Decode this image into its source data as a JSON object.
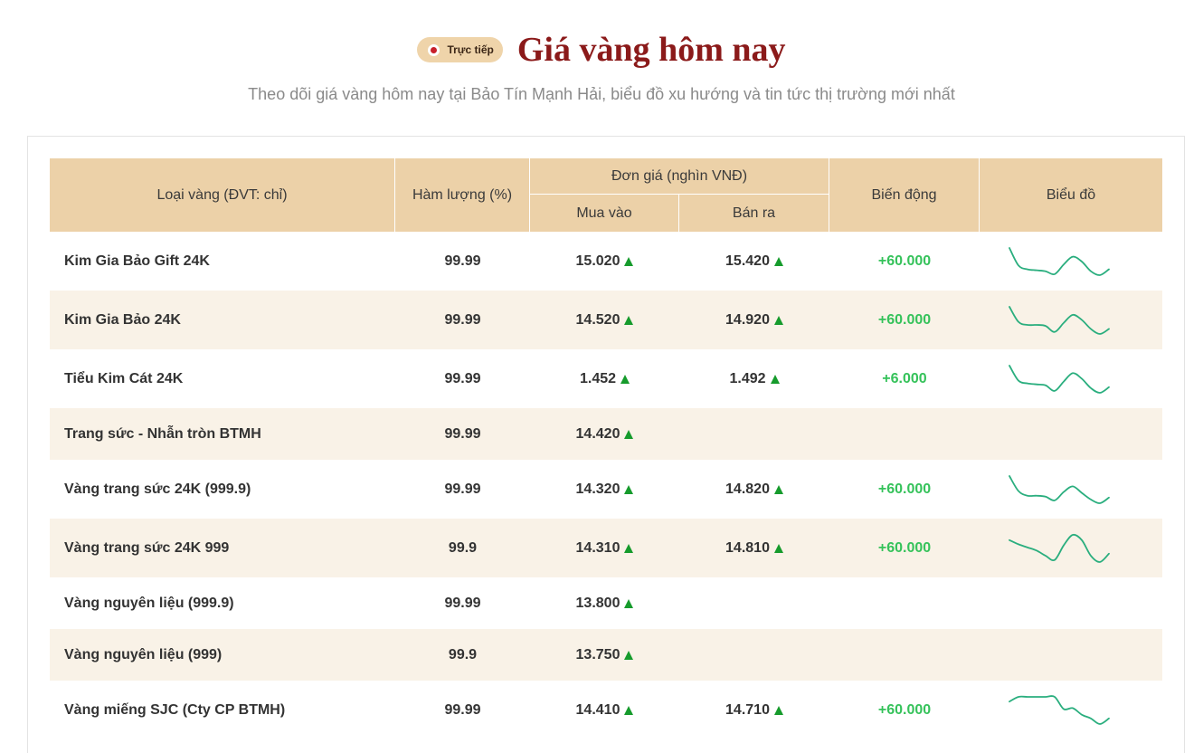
{
  "header": {
    "live_badge": "Trực tiếp",
    "live_icon": "live-dot-icon",
    "title": "Giá vàng hôm nay",
    "subtitle": "Theo dõi giá vàng hôm nay tại Bảo Tín Mạnh Hải, biểu đồ xu hướng và tin tức thị trường mới nhất"
  },
  "table": {
    "columns": {
      "type": "Loại vàng (ĐVT: chỉ)",
      "purity": "Hàm lượng (%)",
      "price_group": "Đơn giá (nghìn VNĐ)",
      "buy": "Mua vào",
      "sell": "Bán ra",
      "change": "Biến động",
      "chart": "Biểu đồ"
    },
    "rows": [
      {
        "name": "Kim Gia Bảo Gift 24K",
        "purity": "99.99",
        "buy": "15.020",
        "buy_icon": "up-arrow-icon",
        "sell": "15.420",
        "sell_icon": "up-arrow-icon",
        "change": "+60.000",
        "sparkline": [
          31,
          13,
          9,
          8,
          7,
          4,
          14,
          22,
          17,
          7,
          3,
          9
        ]
      },
      {
        "name": "Kim Gia Bảo 24K",
        "purity": "99.99",
        "buy": "14.520",
        "buy_icon": "up-arrow-icon",
        "sell": "14.920",
        "sell_icon": "up-arrow-icon",
        "change": "+60.000",
        "sparkline": [
          31,
          16,
          13,
          13,
          12,
          6,
          15,
          23,
          18,
          9,
          4,
          9
        ]
      },
      {
        "name": "Tiểu Kim Cát 24K",
        "purity": "99.99",
        "buy": "1.452",
        "buy_icon": "up-arrow-icon",
        "sell": "1.492",
        "sell_icon": "up-arrow-icon",
        "change": "+6.000",
        "sparkline": [
          31,
          15,
          12,
          11,
          10,
          4,
          14,
          23,
          17,
          7,
          2,
          8
        ]
      },
      {
        "name": "Trang sức - Nhẫn tròn BTMH",
        "purity": "99.99",
        "buy": "14.420",
        "buy_icon": "up-arrow-icon"
      },
      {
        "name": "Vàng trang sức 24K (999.9)",
        "purity": "99.99",
        "buy": "14.320",
        "buy_icon": "up-arrow-icon",
        "sell": "14.820",
        "sell_icon": "up-arrow-icon",
        "change": "+60.000",
        "sparkline": [
          31,
          15,
          10,
          10,
          9,
          5,
          14,
          20,
          13,
          6,
          2,
          8
        ]
      },
      {
        "name": "Vàng trang sức 24K 999",
        "purity": "99.9",
        "buy": "14.310",
        "buy_icon": "up-arrow-icon",
        "sell": "14.810",
        "sell_icon": "up-arrow-icon",
        "change": "+60.000",
        "sparkline": [
          24,
          20,
          17,
          14,
          9,
          5,
          19,
          29,
          24,
          9,
          3,
          11
        ]
      },
      {
        "name": "Vàng nguyên liệu (999.9)",
        "purity": "99.99",
        "buy": "13.800",
        "buy_icon": "up-arrow-icon"
      },
      {
        "name": "Vàng nguyên liệu (999)",
        "purity": "99.9",
        "buy": "13.750",
        "buy_icon": "up-arrow-icon"
      },
      {
        "name": "Vàng miếng SJC (Cty CP BTMH)",
        "purity": "99.99",
        "buy": "14.410",
        "buy_icon": "up-arrow-icon",
        "sell": "14.710",
        "sell_icon": "up-arrow-icon",
        "change": "+60.000",
        "sparkline": [
          26,
          31,
          31,
          31,
          31,
          31,
          18,
          19,
          12,
          8,
          2,
          8
        ]
      }
    ]
  },
  "colors": {
    "title": "#8b1a1a",
    "badge_bg": "#efd4aa",
    "live_dot": "#c8202a",
    "header_bg": "#ecd1a8",
    "row_alt_bg": "#f9f2e7",
    "price_up": "#169b2c",
    "change_positive": "#35c25a",
    "sparkline": "#2aae7e"
  }
}
